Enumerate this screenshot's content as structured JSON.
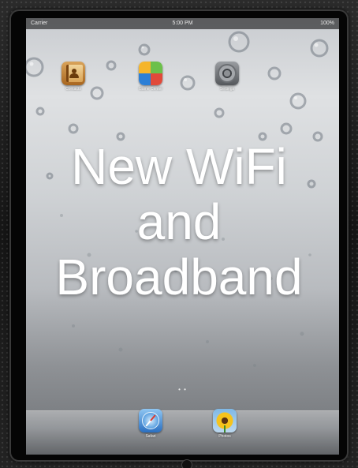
{
  "status_bar": {
    "carrier": "Carrier",
    "time": "5:00 PM",
    "battery": "100%"
  },
  "home_screen": {
    "apps": [
      {
        "name": "Contacts",
        "icon": "contacts-icon"
      },
      {
        "name": "Game Center",
        "icon": "game-center-icon"
      },
      {
        "name": "Settings",
        "icon": "settings-icon"
      }
    ],
    "page_indicator": "• •"
  },
  "dock": {
    "apps": [
      {
        "name": "Safari",
        "icon": "safari-icon"
      },
      {
        "name": "Photos",
        "icon": "photos-icon"
      }
    ]
  },
  "overlay": {
    "lines": [
      "New WiFi",
      "and",
      "Broadband"
    ]
  },
  "colors": {
    "bezel": "#050505",
    "overlay_text": "#ffffff",
    "status_bar_bg": "#000000"
  }
}
